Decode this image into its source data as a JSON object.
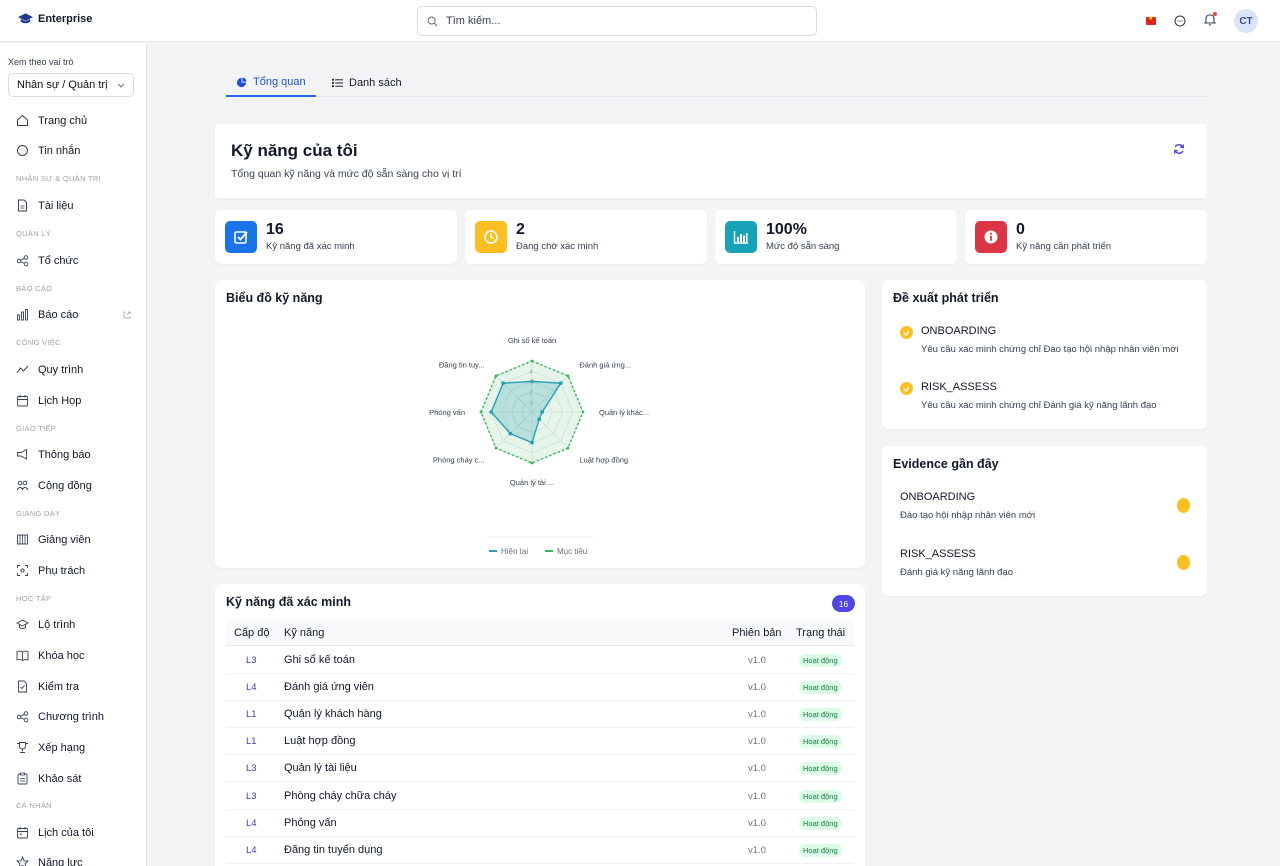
{
  "topbar": {
    "brand": "Enterprise",
    "search_placeholder": "Tìm kiếm...",
    "avatar_initials": "CT"
  },
  "sidebar": {
    "role_label": "Xem theo vai trò",
    "role_value": "Nhân sự / Quản trị",
    "items": [
      {
        "label": "Trang chủ",
        "icon": "home-icon"
      },
      {
        "label": "Tin nhắn",
        "icon": "message-icon"
      },
      {
        "section": "NHÂN SỰ & QUẢN TRỊ"
      },
      {
        "label": "Tài liệu",
        "icon": "document-icon"
      },
      {
        "section": "QUẢN LÝ"
      },
      {
        "label": "Tổ chức",
        "icon": "org-icon"
      },
      {
        "section": "BÁO CÁO"
      },
      {
        "label": "Báo cáo",
        "icon": "chart-icon"
      },
      {
        "section": "CÔNG VIỆC"
      },
      {
        "label": "Quy trình",
        "icon": "workflow-icon"
      },
      {
        "label": "Lịch Họp",
        "icon": "calendar-icon"
      },
      {
        "section": "GIAO TIẾP"
      },
      {
        "label": "Thông báo",
        "icon": "megaphone-icon"
      },
      {
        "label": "Cộng đồng",
        "icon": "community-icon"
      },
      {
        "section": "GIẢNG DẠY"
      },
      {
        "label": "Giảng viên",
        "icon": "instructor-icon"
      },
      {
        "label": "Phụ trách",
        "icon": "focus-icon"
      },
      {
        "section": "HỌC TẬP"
      },
      {
        "label": "Lộ trình",
        "icon": "graduation-icon"
      },
      {
        "label": "Khóa học",
        "icon": "book-icon"
      },
      {
        "label": "Kiểm tra",
        "icon": "test-icon"
      },
      {
        "label": "Chương trình",
        "icon": "program-icon"
      },
      {
        "label": "Xếp hạng",
        "icon": "trophy-icon"
      },
      {
        "label": "Khảo sát",
        "icon": "survey-icon"
      },
      {
        "section": "CÁ NHÂN"
      },
      {
        "label": "Lịch của tôi",
        "icon": "my-calendar-icon"
      },
      {
        "label": "Năng lực",
        "icon": "star-icon"
      }
    ]
  },
  "tabs": [
    {
      "label": "Tổng quan",
      "icon": "pie-icon"
    },
    {
      "label": "Danh sách",
      "icon": "list-icon"
    }
  ],
  "header": {
    "title": "Kỹ năng của tôi",
    "subtitle": "Tổng quan kỹ năng và mức độ sẵn sàng cho vị trí"
  },
  "stats": [
    {
      "value": "16",
      "label": "Kỹ năng đã xác minh",
      "color": "#1a73e8",
      "icon": "check-square-icon"
    },
    {
      "value": "2",
      "label": "Đang chờ xác minh",
      "color": "#fbbf24",
      "icon": "clock-icon"
    },
    {
      "value": "100%",
      "label": "Mức độ sẵn sàng",
      "color": "#17a2b8",
      "icon": "bar-chart-icon"
    },
    {
      "value": "0",
      "label": "Kỹ năng cần phát triển",
      "color": "#dc3545",
      "icon": "info-icon"
    }
  ],
  "chart_card": {
    "title": "Biểu đồ kỹ năng"
  },
  "chart_data": {
    "type": "radar",
    "categories": [
      "Ghi sổ kế toán",
      "Đánh giá ứng...",
      "Quản lý khác...",
      "Luật hợp đồng",
      "Quản lý tài ...",
      "Phòng cháy c...",
      "Phỏng vấn",
      "Đăng tin tuy..."
    ],
    "series": [
      {
        "name": "Hiện tại",
        "values": [
          3,
          4,
          1,
          1,
          3,
          3,
          4,
          4
        ],
        "color": "#2a9fb4"
      },
      {
        "name": "Mục tiêu",
        "values": [
          5,
          5,
          5,
          5,
          5,
          5,
          5,
          5
        ],
        "color": "#3cb45a"
      }
    ],
    "rmax": 5,
    "ticks": [
      "1",
      "2",
      "3",
      "4"
    ],
    "legend": "bottom"
  },
  "recommendations": {
    "title": "Đề xuất phát triển",
    "items": [
      {
        "code": "ONBOARDING",
        "desc": "Yêu cầu xác minh chứng chỉ Đào tạo hội nhập nhân viên mới"
      },
      {
        "code": "RISK_ASSESS",
        "desc": "Yêu cầu xác minh chứng chỉ Đánh giá kỹ năng lãnh đạo"
      }
    ]
  },
  "evidence": {
    "title": "Evidence gần đây",
    "items": [
      {
        "code": "ONBOARDING",
        "desc": "Đào tạo hội nhập nhân viên mới"
      },
      {
        "code": "RISK_ASSESS",
        "desc": "Đánh giá kỹ năng lãnh đạo"
      }
    ]
  },
  "verified_table": {
    "title": "Kỹ năng đã xác minh",
    "count": "16",
    "columns": [
      "Cấp độ",
      "Kỹ năng",
      "Phiên bản",
      "Trạng thái"
    ],
    "rows": [
      {
        "level": "L3",
        "skill": "Ghi sổ kế toán",
        "version": "v1.0",
        "status": "Hoạt động"
      },
      {
        "level": "L4",
        "skill": "Đánh giá ứng viên",
        "version": "v1.0",
        "status": "Hoạt động"
      },
      {
        "level": "L1",
        "skill": "Quản lý khách hàng",
        "version": "v1.0",
        "status": "Hoạt động"
      },
      {
        "level": "L1",
        "skill": "Luật hợp đồng",
        "version": "v1.0",
        "status": "Hoạt động"
      },
      {
        "level": "L3",
        "skill": "Quản lý tài liệu",
        "version": "v1.0",
        "status": "Hoạt động"
      },
      {
        "level": "L3",
        "skill": "Phòng cháy chữa cháy",
        "version": "v1.0",
        "status": "Hoạt động"
      },
      {
        "level": "L4",
        "skill": "Phỏng vấn",
        "version": "v1.0",
        "status": "Hoạt động"
      },
      {
        "level": "L4",
        "skill": "Đăng tin tuyển dụng",
        "version": "v1.0",
        "status": "Hoạt động"
      }
    ]
  }
}
